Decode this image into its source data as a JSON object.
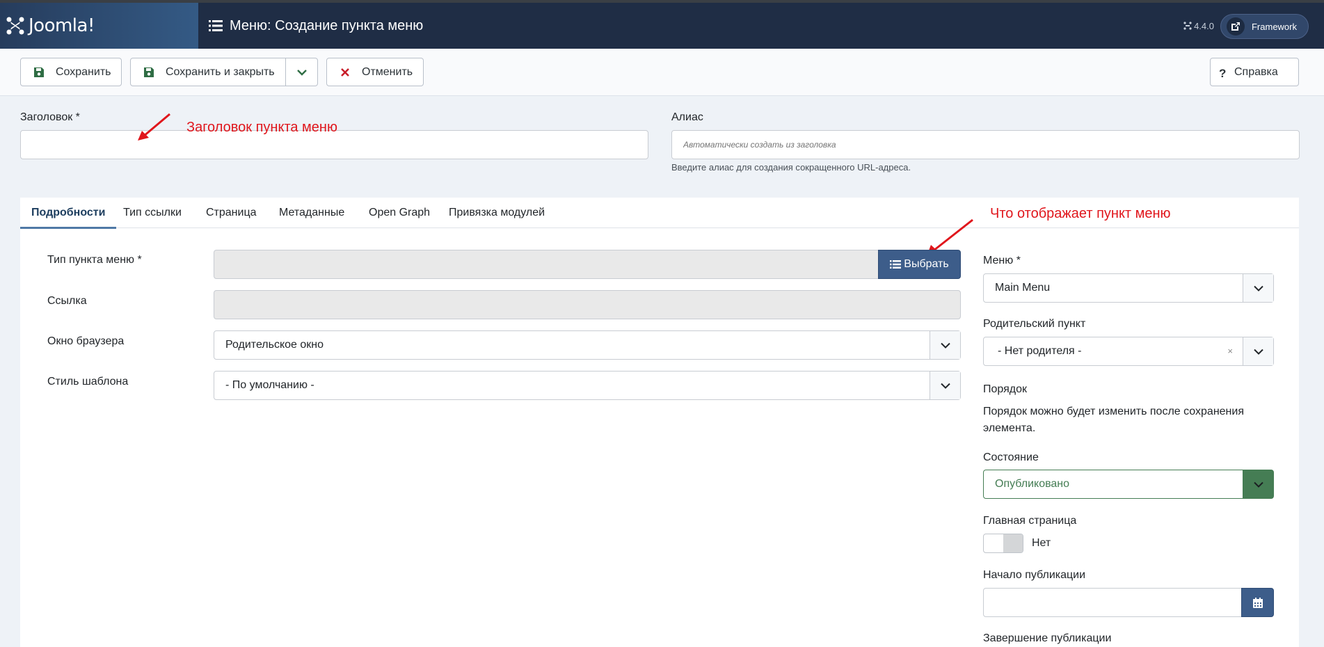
{
  "header": {
    "logo_text": "Joomla!",
    "title": "Меню: Создание пункта меню",
    "version": "4.4.0",
    "site_button": "Framework"
  },
  "toolbar": {
    "save": "Сохранить",
    "save_close": "Сохранить и закрыть",
    "cancel": "Отменить",
    "help": "Справка"
  },
  "form": {
    "title_label": "Заголовок *",
    "title_value": "",
    "alias_label": "Алиас",
    "alias_placeholder": "Автоматически создать из заголовка",
    "alias_hint": "Введите алиас для создания сокращенного URL-адреса."
  },
  "annotations": {
    "title_note": "Заголовок пункта меню",
    "type_note": "Что отображает пункт меню"
  },
  "tabs": [
    {
      "label": "Подробности",
      "active": true
    },
    {
      "label": "Тип ссылки",
      "active": false
    },
    {
      "label": "Страница",
      "active": false
    },
    {
      "label": "Метаданные",
      "active": false
    },
    {
      "label": "Open Graph",
      "active": false
    },
    {
      "label": "Привязка модулей",
      "active": false
    }
  ],
  "details": {
    "type_label": "Тип пункта меню *",
    "choose_button": "Выбрать",
    "link_label": "Ссылка",
    "window_label": "Окно браузера",
    "window_value": "Родительское окно",
    "style_label": "Стиль шаблона",
    "style_value": "- По умолчанию -"
  },
  "sidebar": {
    "menu_label": "Меню *",
    "menu_value": "Main Menu",
    "parent_label": "Родительский пункт",
    "parent_value": "- Нет родителя -",
    "order_label": "Порядок",
    "order_text": "Порядок можно будет изменить после сохранения элемента.",
    "state_label": "Состояние",
    "state_value": "Опубликовано",
    "home_label": "Главная страница",
    "home_value": "Нет",
    "publish_up_label": "Начало публикации",
    "publish_down_label": "Завершение публикации"
  },
  "colors": {
    "header_bg": "#1f2d45",
    "primary": "#3d5d8a",
    "published": "#457d54",
    "annotation": "#e0161c"
  }
}
